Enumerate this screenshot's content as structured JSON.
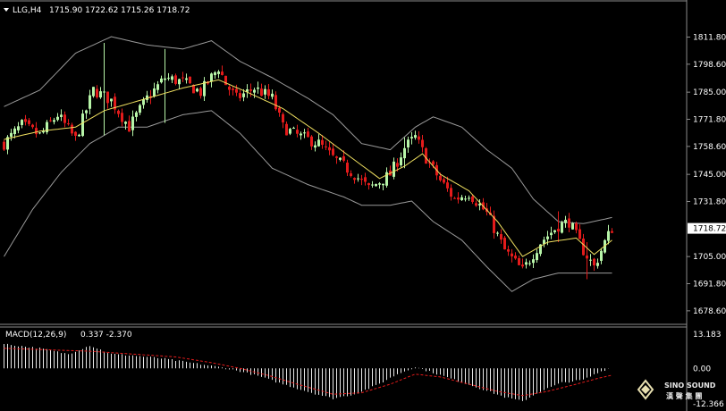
{
  "header": {
    "symbol": "LLG,H4",
    "ohlc": "1715.90 1722.62 1715.26 1718.72"
  },
  "macd": {
    "label": "MACD(12,26,9)",
    "values": "0.337 -2.370",
    "ticks": [
      "13.183",
      "0.00",
      "-12.366"
    ]
  },
  "logo": {
    "brand": "SINO SOUND",
    "sub": "漢 聲 集 團"
  },
  "colors": {
    "background": "#000000",
    "bull": "#b7f5a8",
    "bear": "#e31b1b",
    "ma": "#f0e060",
    "bands": "#9a9a9a",
    "macd_hist": "#e8e8e8",
    "macd_signal": "#e31b1b",
    "price_tag": "#ffffff"
  },
  "chart_data": [
    {
      "type": "candlestick",
      "title": "LLG,H4",
      "y_ticks": [
        1811.8,
        1798.6,
        1785.0,
        1771.8,
        1758.6,
        1745.0,
        1731.8,
        1718.72,
        1705.0,
        1691.8,
        1678.6
      ],
      "ylim": [
        1675.5,
        1825.5
      ],
      "current_price": 1718.72,
      "overlays": [
        "moving-average",
        "bollinger-bands"
      ],
      "candle_count": 171,
      "close_path": [
        [
          0,
          1760
        ],
        [
          5,
          1769
        ],
        [
          10,
          1764
        ],
        [
          15,
          1774
        ],
        [
          20,
          1762
        ],
        [
          25,
          1786
        ],
        [
          30,
          1781
        ],
        [
          35,
          1768
        ],
        [
          40,
          1782
        ],
        [
          45,
          1792
        ],
        [
          50,
          1790
        ],
        [
          55,
          1785
        ],
        [
          60,
          1797
        ],
        [
          62,
          1789
        ],
        [
          65,
          1782
        ],
        [
          70,
          1787
        ],
        [
          75,
          1782
        ],
        [
          78,
          1768
        ],
        [
          82,
          1764
        ],
        [
          88,
          1760
        ],
        [
          92,
          1753
        ],
        [
          98,
          1745
        ],
        [
          102,
          1738
        ],
        [
          108,
          1745
        ],
        [
          112,
          1758
        ],
        [
          115,
          1763
        ],
        [
          118,
          1753
        ],
        [
          122,
          1742
        ],
        [
          126,
          1733
        ],
        [
          130,
          1736
        ],
        [
          135,
          1726
        ],
        [
          140,
          1708
        ],
        [
          145,
          1698
        ],
        [
          150,
          1712
        ],
        [
          155,
          1720
        ],
        [
          158,
          1722
        ],
        [
          162,
          1708
        ],
        [
          165,
          1700
        ],
        [
          168,
          1712
        ],
        [
          170,
          1718.72
        ]
      ],
      "spikes": [
        [
          28,
          1809,
          1764
        ],
        [
          45,
          1806,
          1770
        ],
        [
          112,
          1763,
          1748
        ],
        [
          155,
          1727,
          1712
        ],
        [
          163,
          1712,
          1694
        ]
      ],
      "ma_path": [
        [
          0,
          1762
        ],
        [
          10,
          1766
        ],
        [
          20,
          1768
        ],
        [
          28,
          1776
        ],
        [
          40,
          1782
        ],
        [
          50,
          1787
        ],
        [
          60,
          1791
        ],
        [
          68,
          1785
        ],
        [
          78,
          1777
        ],
        [
          88,
          1765
        ],
        [
          98,
          1752
        ],
        [
          105,
          1743
        ],
        [
          112,
          1749
        ],
        [
          117,
          1755
        ],
        [
          122,
          1745
        ],
        [
          130,
          1737
        ],
        [
          138,
          1722
        ],
        [
          145,
          1705
        ],
        [
          152,
          1712
        ],
        [
          160,
          1714
        ],
        [
          165,
          1706
        ],
        [
          170,
          1713
        ]
      ],
      "upper_band_path": [
        [
          0,
          1778
        ],
        [
          10,
          1786
        ],
        [
          20,
          1804
        ],
        [
          30,
          1812
        ],
        [
          40,
          1808
        ],
        [
          50,
          1806
        ],
        [
          58,
          1810
        ],
        [
          66,
          1800
        ],
        [
          75,
          1792
        ],
        [
          85,
          1782
        ],
        [
          92,
          1774
        ],
        [
          100,
          1760
        ],
        [
          108,
          1757
        ],
        [
          115,
          1768
        ],
        [
          120,
          1773
        ],
        [
          128,
          1768
        ],
        [
          135,
          1757
        ],
        [
          142,
          1748
        ],
        [
          148,
          1733
        ],
        [
          155,
          1722
        ],
        [
          162,
          1721
        ],
        [
          170,
          1724
        ]
      ],
      "lower_band_path": [
        [
          0,
          1705
        ],
        [
          8,
          1728
        ],
        [
          16,
          1746
        ],
        [
          24,
          1760
        ],
        [
          32,
          1768
        ],
        [
          40,
          1768
        ],
        [
          50,
          1774
        ],
        [
          58,
          1776
        ],
        [
          66,
          1765
        ],
        [
          75,
          1748
        ],
        [
          85,
          1740
        ],
        [
          95,
          1734
        ],
        [
          100,
          1730
        ],
        [
          108,
          1730
        ],
        [
          114,
          1732
        ],
        [
          120,
          1722
        ],
        [
          128,
          1713
        ],
        [
          135,
          1700
        ],
        [
          142,
          1688
        ],
        [
          148,
          1694
        ],
        [
          155,
          1697
        ],
        [
          162,
          1697
        ],
        [
          170,
          1697
        ]
      ]
    },
    {
      "type": "bar",
      "title": "MACD(12,26,9)",
      "ylim": [
        -12.366,
        13.183
      ],
      "histogram_path": [
        [
          0,
          8.5
        ],
        [
          10,
          7.0
        ],
        [
          18,
          5.0
        ],
        [
          24,
          8.0
        ],
        [
          30,
          5.0
        ],
        [
          36,
          4.5
        ],
        [
          44,
          3.5
        ],
        [
          52,
          2.0
        ],
        [
          60,
          0.5
        ],
        [
          66,
          -1.0
        ],
        [
          72,
          -3.0
        ],
        [
          78,
          -5.5
        ],
        [
          86,
          -8.5
        ],
        [
          92,
          -10.5
        ],
        [
          98,
          -9.0
        ],
        [
          104,
          -6.0
        ],
        [
          110,
          -2.0
        ],
        [
          115,
          0.5
        ],
        [
          120,
          -1.5
        ],
        [
          126,
          -4.0
        ],
        [
          132,
          -6.5
        ],
        [
          140,
          -10.0
        ],
        [
          145,
          -11.5
        ],
        [
          150,
          -8.0
        ],
        [
          156,
          -5.0
        ],
        [
          162,
          -4.0
        ],
        [
          167,
          -1.0
        ],
        [
          170,
          0.337
        ]
      ],
      "signal_path": [
        [
          0,
          7.0
        ],
        [
          12,
          6.5
        ],
        [
          24,
          6.0
        ],
        [
          36,
          5.0
        ],
        [
          48,
          4.0
        ],
        [
          58,
          2.0
        ],
        [
          66,
          0.0
        ],
        [
          74,
          -2.5
        ],
        [
          82,
          -5.5
        ],
        [
          92,
          -9.0
        ],
        [
          100,
          -8.5
        ],
        [
          108,
          -5.5
        ],
        [
          115,
          -2.0
        ],
        [
          122,
          -3.0
        ],
        [
          130,
          -5.5
        ],
        [
          138,
          -8.0
        ],
        [
          145,
          -9.5
        ],
        [
          152,
          -8.0
        ],
        [
          160,
          -5.5
        ],
        [
          166,
          -3.5
        ],
        [
          170,
          -2.37
        ]
      ]
    }
  ]
}
